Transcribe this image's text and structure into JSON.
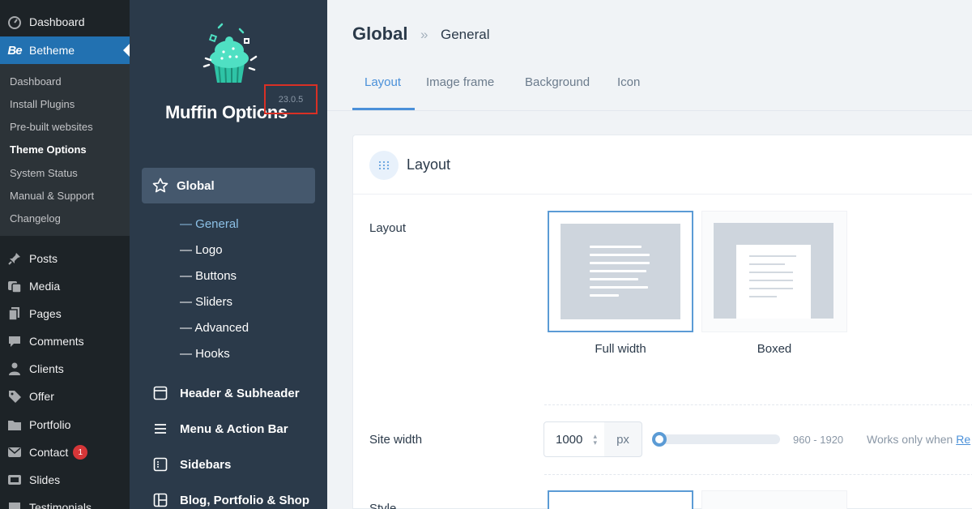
{
  "wp_menu": {
    "dashboard": "Dashboard",
    "betheme": "Betheme",
    "betheme_logo": "Be",
    "submenu": [
      "Dashboard",
      "Install Plugins",
      "Pre-built websites",
      "Theme Options",
      "System Status",
      "Manual & Support",
      "Changelog"
    ],
    "items": {
      "posts": "Posts",
      "media": "Media",
      "pages": "Pages",
      "comments": "Comments",
      "clients": "Clients",
      "offer": "Offer",
      "portfolio": "Portfolio",
      "contact": "Contact",
      "contact_badge": "1",
      "slides": "Slides",
      "testimonials": "Testimonials"
    }
  },
  "muffin": {
    "title": "Muffin Options",
    "version": "23.0.5",
    "nav_global": "Global",
    "global_sub": [
      "General",
      "Logo",
      "Buttons",
      "Sliders",
      "Advanced",
      "Hooks"
    ],
    "nav": {
      "header": "Header & Subheader",
      "menu": "Menu & Action Bar",
      "sidebars": "Sidebars",
      "blog": "Blog, Portfolio & Shop"
    }
  },
  "main": {
    "breadcrumb_main": "Global",
    "breadcrumb_sep": "»",
    "breadcrumb_sub": "General",
    "tabs": [
      "Layout",
      "Image frame",
      "Background",
      "Icon"
    ],
    "active_tab": "Layout",
    "card_title": "Layout",
    "layout_label": "Layout",
    "options": [
      "Full width",
      "Boxed"
    ],
    "selected_option": "Full width",
    "site_width_label": "Site width",
    "site_width_value": "1000",
    "unit": "px",
    "range": "960 - 1920",
    "note_prefix": "Works only when",
    "note_link": "Re",
    "style_label": "Style"
  },
  "colors": {
    "wp_bg": "#1d2327",
    "wp_active": "#2271b1",
    "muffin_bg": "#2b3a4a",
    "accent": "#4a90d9",
    "highlight_box": "#d93025"
  }
}
